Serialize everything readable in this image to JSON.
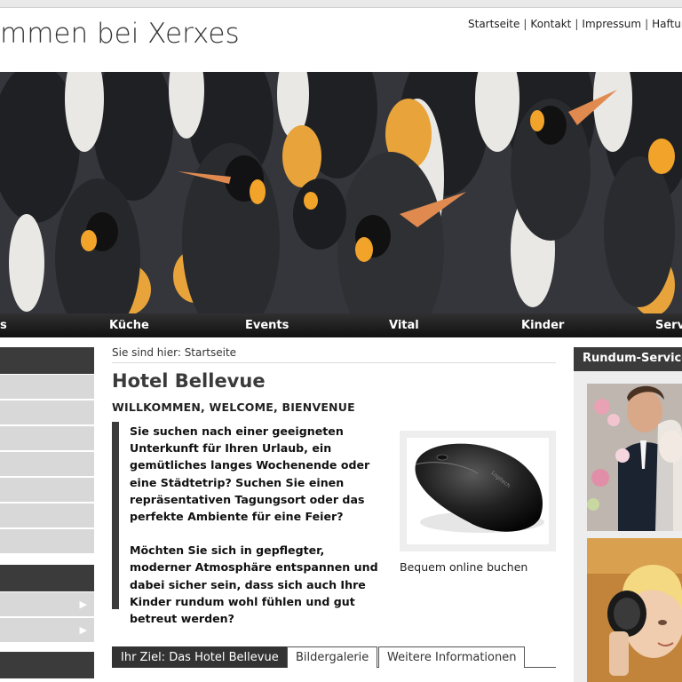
{
  "header": {
    "site_title": "mmen bei Xerxes",
    "meta_nav": [
      "Startseite",
      "Kontakt",
      "Impressum",
      "Haftun"
    ]
  },
  "main_nav": [
    "s",
    "Küche",
    "Events",
    "Vital",
    "Kinder",
    "Serv"
  ],
  "breadcrumb": {
    "label": "Sie sind hier:",
    "current": "Startseite"
  },
  "content": {
    "title": "Hotel Bellevue",
    "subhead": "WILLKOMMEN, WELCOME, BIENVENUE",
    "paragraph1": "Sie suchen nach einer geeigneten Unterkunft für Ihren Urlaub, ein gemütliches langes Wochenende oder eine Städtetrip? Suchen Sie einen repräsentativen Tagungsort oder das perfekte Ambiente für eine Feier?",
    "paragraph2": "Möchten Sie sich in gepflegter, moderner Atmosphäre entspannen und dabei sicher sein, dass sich auch Ihre Kinder rundum wohl fühlen und gut betreut werden?",
    "image_caption": "Bequem online buchen"
  },
  "tabs": [
    "Ihr Ziel: Das Hotel Bellevue",
    "Bildergalerie",
    "Weitere Informationen"
  ],
  "right_column": {
    "heading": "Rundum-Service"
  },
  "colors": {
    "dark_bar": "#3b3b3b",
    "sidebar_box": "#d8d8d8"
  }
}
